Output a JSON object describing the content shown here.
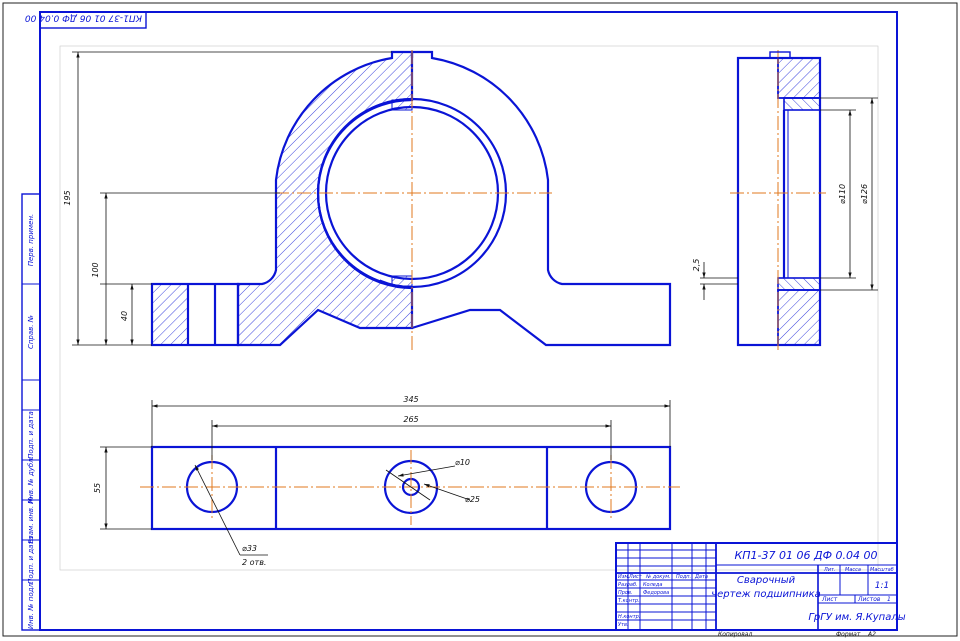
{
  "colors": {
    "line": "#0a14d6",
    "axis": "#e07a1f",
    "text": "#111111",
    "paper": "#ffffff"
  },
  "corner_stamp": "КП1-37 01 06 ДФ 0.04 00",
  "front_view": {
    "dim_height": "195",
    "dim_axis": "100",
    "dim_base": "40"
  },
  "side_view": {
    "dim_bore": "⌀110",
    "dim_outer": "⌀126",
    "dim_gap": "2,5"
  },
  "top_view": {
    "dim_length": "345",
    "dim_spacing": "265",
    "dim_width": "55",
    "dim_small_hole": "⌀10",
    "dim_center_hole": "⌀25",
    "dim_bolt_hole": "⌀33",
    "bolt_hole_count": "2 отв."
  },
  "left_strip": [
    "Перв. примен.",
    "Справ. №",
    "Подп. и дата",
    "Инв. № дубл.",
    "Взам. инв. №",
    "Подп. и дата",
    "Инв. № подл."
  ],
  "title_block": {
    "designation": "КП1-37 01 06 ДФ 0.04 00",
    "title_line1": "Сварочный",
    "title_line2": "чертеж подшипника",
    "head_lit": "Лит.",
    "head_mass": "Масса",
    "head_scale": "Масштаб",
    "scale": "1:1",
    "sheet_label": "Лист",
    "sheets_label": "Листов",
    "sheets_total": "1",
    "organization": "ГрГУ им. Я.Купалы",
    "row_labels": [
      "Изм.",
      "Лист",
      "№ докум.",
      "Подп.",
      "Дата"
    ],
    "roles": [
      "Разраб.",
      "Пров.",
      "Т.контр.",
      "",
      "Н.контр.",
      "Утв."
    ],
    "names": [
      "Коледа",
      "Федорова"
    ],
    "copied": "Копировал",
    "format_label": "Формат",
    "format": "А2"
  }
}
